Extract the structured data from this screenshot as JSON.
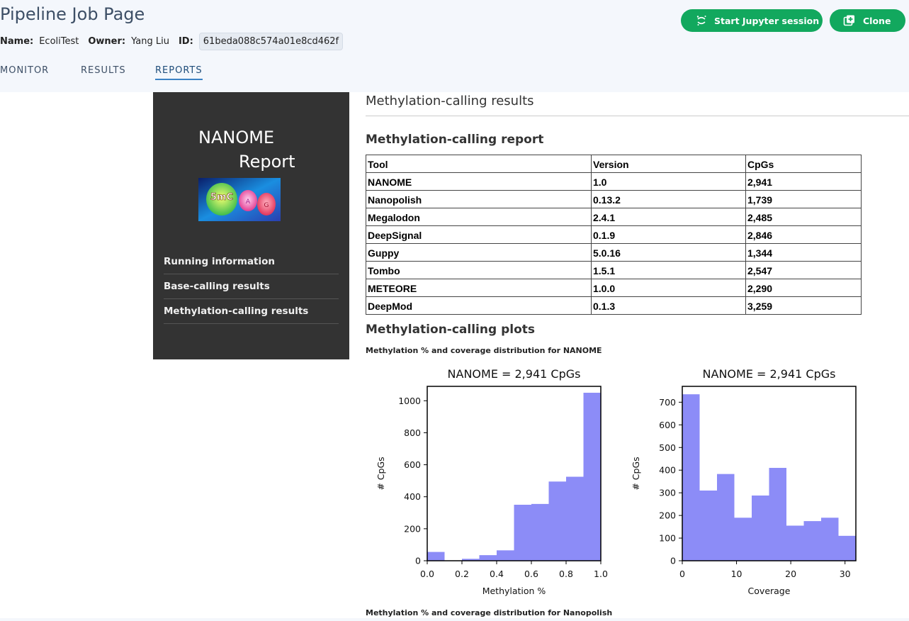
{
  "header": {
    "title": "Pipeline Job Page",
    "name_label": "Name:",
    "name_value": "EcoliTest",
    "owner_label": "Owner:",
    "owner_value": "Yang Liu",
    "id_label": "ID:",
    "id_value": "61beda088c574a01e8cd462f",
    "buttons": {
      "jupyter": "Start Jupyter session",
      "clone": "Clone"
    },
    "accent_color": "#12a85e"
  },
  "tabs": [
    {
      "label": "MONITOR"
    },
    {
      "label": "RESULTS"
    },
    {
      "label": "REPORTS",
      "active": true
    }
  ],
  "sidebar": {
    "title_line1": "NANOME",
    "title_line2": "Report",
    "logo_text": "5mC",
    "items": [
      {
        "label": "Running information"
      },
      {
        "label": "Base-calling results"
      },
      {
        "label": "Methylation-calling results"
      }
    ]
  },
  "content": {
    "section_title": "Methylation-calling results",
    "report_heading": "Methylation-calling report",
    "table": {
      "headers": [
        "Tool",
        "Version",
        "CpGs"
      ],
      "rows": [
        [
          "NANOME",
          "1.0",
          "2,941"
        ],
        [
          "Nanopolish",
          "0.13.2",
          "1,739"
        ],
        [
          "Megalodon",
          "2.4.1",
          "2,485"
        ],
        [
          "DeepSignal",
          "0.1.9",
          "2,846"
        ],
        [
          "Guppy",
          "5.0.16",
          "1,344"
        ],
        [
          "Tombo",
          "1.5.1",
          "2,547"
        ],
        [
          "METEORE",
          "1.0.0",
          "2,290"
        ],
        [
          "DeepMod",
          "0.1.3",
          "3,259"
        ]
      ]
    },
    "plots_heading": "Methylation-calling plots",
    "caption_nanome": "Methylation % and coverage distribution for NANOME",
    "caption_nanopolish": "Methylation % and coverage distribution for Nanopolish"
  },
  "chart_data": [
    {
      "type": "bar",
      "title": "NANOME = 2,941 CpGs",
      "xlabel": "Methylation %",
      "ylabel": "# CpGs",
      "bin_edges": [
        0.0,
        0.1,
        0.2,
        0.3,
        0.4,
        0.5,
        0.6,
        0.7,
        0.8,
        0.9,
        1.0
      ],
      "values": [
        55,
        2,
        12,
        35,
        65,
        350,
        355,
        495,
        525,
        1050
      ],
      "xlim": [
        0.0,
        1.0
      ],
      "ylim": [
        0,
        1090
      ],
      "xticks": [
        "0.0",
        "0.2",
        "0.4",
        "0.6",
        "0.8",
        "1.0"
      ],
      "yticks": [
        "0",
        "200",
        "400",
        "600",
        "800",
        "1000"
      ],
      "bar_color": "#8c8cf7",
      "grid": false
    },
    {
      "type": "bar",
      "title": "NANOME = 2,941 CpGs",
      "xlabel": "Coverage",
      "ylabel": "# CpGs",
      "bin_edges": [
        0,
        3.2,
        6.4,
        9.6,
        12.8,
        16,
        19.2,
        22.4,
        25.6,
        28.8,
        32
      ],
      "values": [
        735,
        310,
        383,
        190,
        288,
        410,
        155,
        175,
        190,
        110
      ],
      "xlim": [
        0,
        32
      ],
      "ylim": [
        0,
        770
      ],
      "xticks": [
        "0",
        "10",
        "20",
        "30"
      ],
      "yticks": [
        "0",
        "100",
        "200",
        "300",
        "400",
        "500",
        "600",
        "700"
      ],
      "bar_color": "#8c8cf7",
      "grid": false
    }
  ]
}
